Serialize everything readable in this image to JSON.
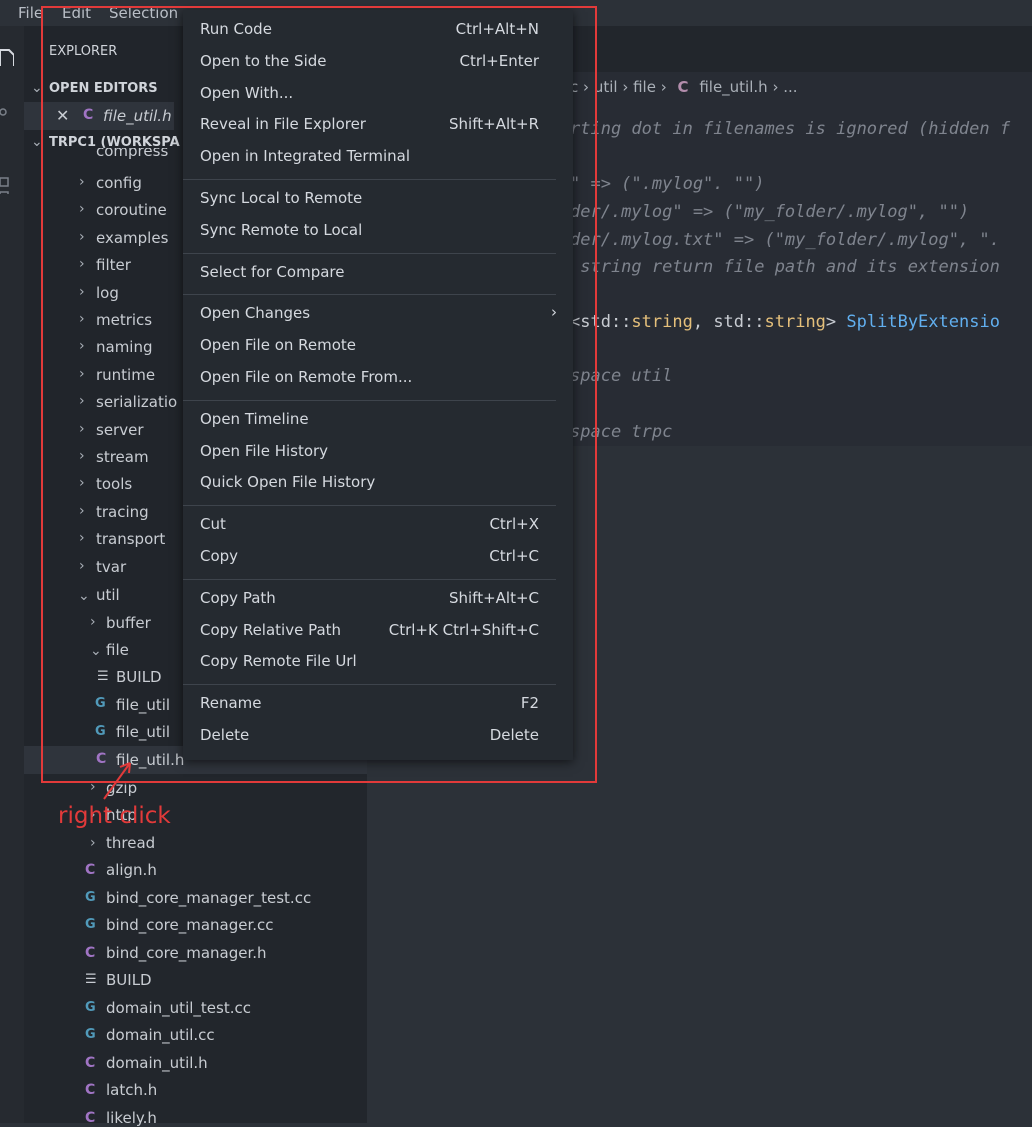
{
  "menubar": {
    "file": "File",
    "edit": "Edit",
    "selection": "Selection"
  },
  "explorer": {
    "title": "EXPLORER",
    "open_editors_header": "OPEN EDITORS",
    "open_editor_file": "file_util.h",
    "workspace_header": "TRPC1 (WORKSPA",
    "partial_top": "compress",
    "folders": [
      "config",
      "coroutine",
      "examples",
      "filter",
      "log",
      "metrics",
      "naming",
      "runtime",
      "serializatio",
      "server",
      "stream",
      "tools",
      "tracing",
      "transport",
      "tvar"
    ],
    "util": "util",
    "buffer": "buffer",
    "file": "file",
    "file_children": [
      "BUILD",
      "file_util",
      "file_util",
      "file_util.h"
    ],
    "gzip": "gzip",
    "http": "http",
    "thread": "thread",
    "util_files": [
      "align.h",
      "bind_core_manager_test.cc",
      "bind_core_manager.cc",
      "bind_core_manager.h",
      "BUILD",
      "domain_util_test.cc",
      "domain_util.cc",
      "domain_util.h",
      "latch.h",
      "likely.h"
    ]
  },
  "breadcrumb": {
    "part1": "c",
    "part2": "util",
    "part3": "file",
    "part4": "file_util.h",
    "part5": "..."
  },
  "code": {
    "line1": "rting dot in filenames is ignored (hidden f",
    "line2": "\" => (\".mylog\". \"\")",
    "line3": "der/.mylog\" => (\"my_folder/.mylog\", \"\")",
    "line4": "der/.mylog.txt\" => (\"my_folder/.mylog\", \".",
    "line5": " string return file path and its extension",
    "line6_a": "<std::",
    "line6_b": "string",
    "line6_c": ", std::",
    "line6_d": "string",
    "line6_e": "> ",
    "line6_f": "SplitByExtensio",
    "line7": "space util",
    "line8": "space trpc"
  },
  "context_menu": {
    "groups": [
      [
        {
          "label": "Run Code",
          "shortcut": "Ctrl+Alt+N"
        },
        {
          "label": "Open to the Side",
          "shortcut": "Ctrl+Enter"
        },
        {
          "label": "Open With...",
          "shortcut": ""
        },
        {
          "label": "Reveal in File Explorer",
          "shortcut": "Shift+Alt+R"
        },
        {
          "label": "Open in Integrated Terminal",
          "shortcut": ""
        }
      ],
      [
        {
          "label": "Sync Local to Remote",
          "shortcut": ""
        },
        {
          "label": "Sync Remote to Local",
          "shortcut": ""
        }
      ],
      [
        {
          "label": "Select for Compare",
          "shortcut": ""
        }
      ],
      [
        {
          "label": "Open Changes",
          "shortcut": "",
          "submenu": true
        },
        {
          "label": "Open File on Remote",
          "shortcut": ""
        },
        {
          "label": "Open File on Remote From...",
          "shortcut": ""
        }
      ],
      [
        {
          "label": "Open Timeline",
          "shortcut": ""
        },
        {
          "label": "Open File History",
          "shortcut": ""
        },
        {
          "label": "Quick Open File History",
          "shortcut": ""
        }
      ],
      [
        {
          "label": "Cut",
          "shortcut": "Ctrl+X"
        },
        {
          "label": "Copy",
          "shortcut": "Ctrl+C"
        }
      ],
      [
        {
          "label": "Copy Path",
          "shortcut": "Shift+Alt+C"
        },
        {
          "label": "Copy Relative Path",
          "shortcut": "Ctrl+K Ctrl+Shift+C"
        },
        {
          "label": "Copy Remote File Url",
          "shortcut": ""
        }
      ],
      [
        {
          "label": "Rename",
          "shortcut": "F2"
        },
        {
          "label": "Delete",
          "shortcut": "Delete"
        }
      ]
    ]
  },
  "annotation": {
    "text": "right click",
    "color": "#e23a3a"
  }
}
